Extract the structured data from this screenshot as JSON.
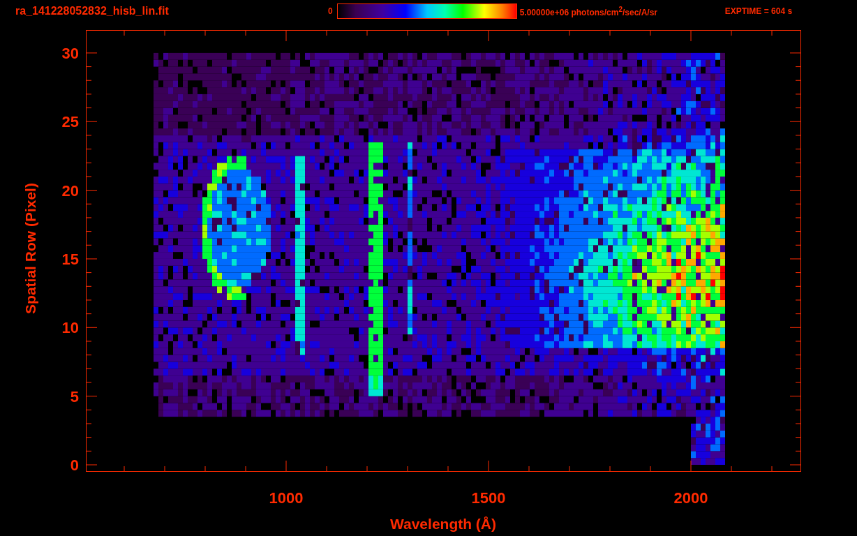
{
  "header": {
    "filename": "ra_141228052832_hisb_lin.fit",
    "colorbar": {
      "min_label": "0",
      "max_label": "5.00000e+06 photons/cm$^{2}$/sec/A/sr"
    },
    "exposure": "EXPTIME = 604 s"
  },
  "plot": {
    "xlabel": "Wavelength (Å)",
    "ylabel": "Spatial Row (Pixel)",
    "xtick_labels": [
      "1000",
      "1500",
      "2000"
    ],
    "ytick_labels": [
      "30",
      "25",
      "20",
      "15",
      "10",
      "5",
      "0"
    ]
  }
}
